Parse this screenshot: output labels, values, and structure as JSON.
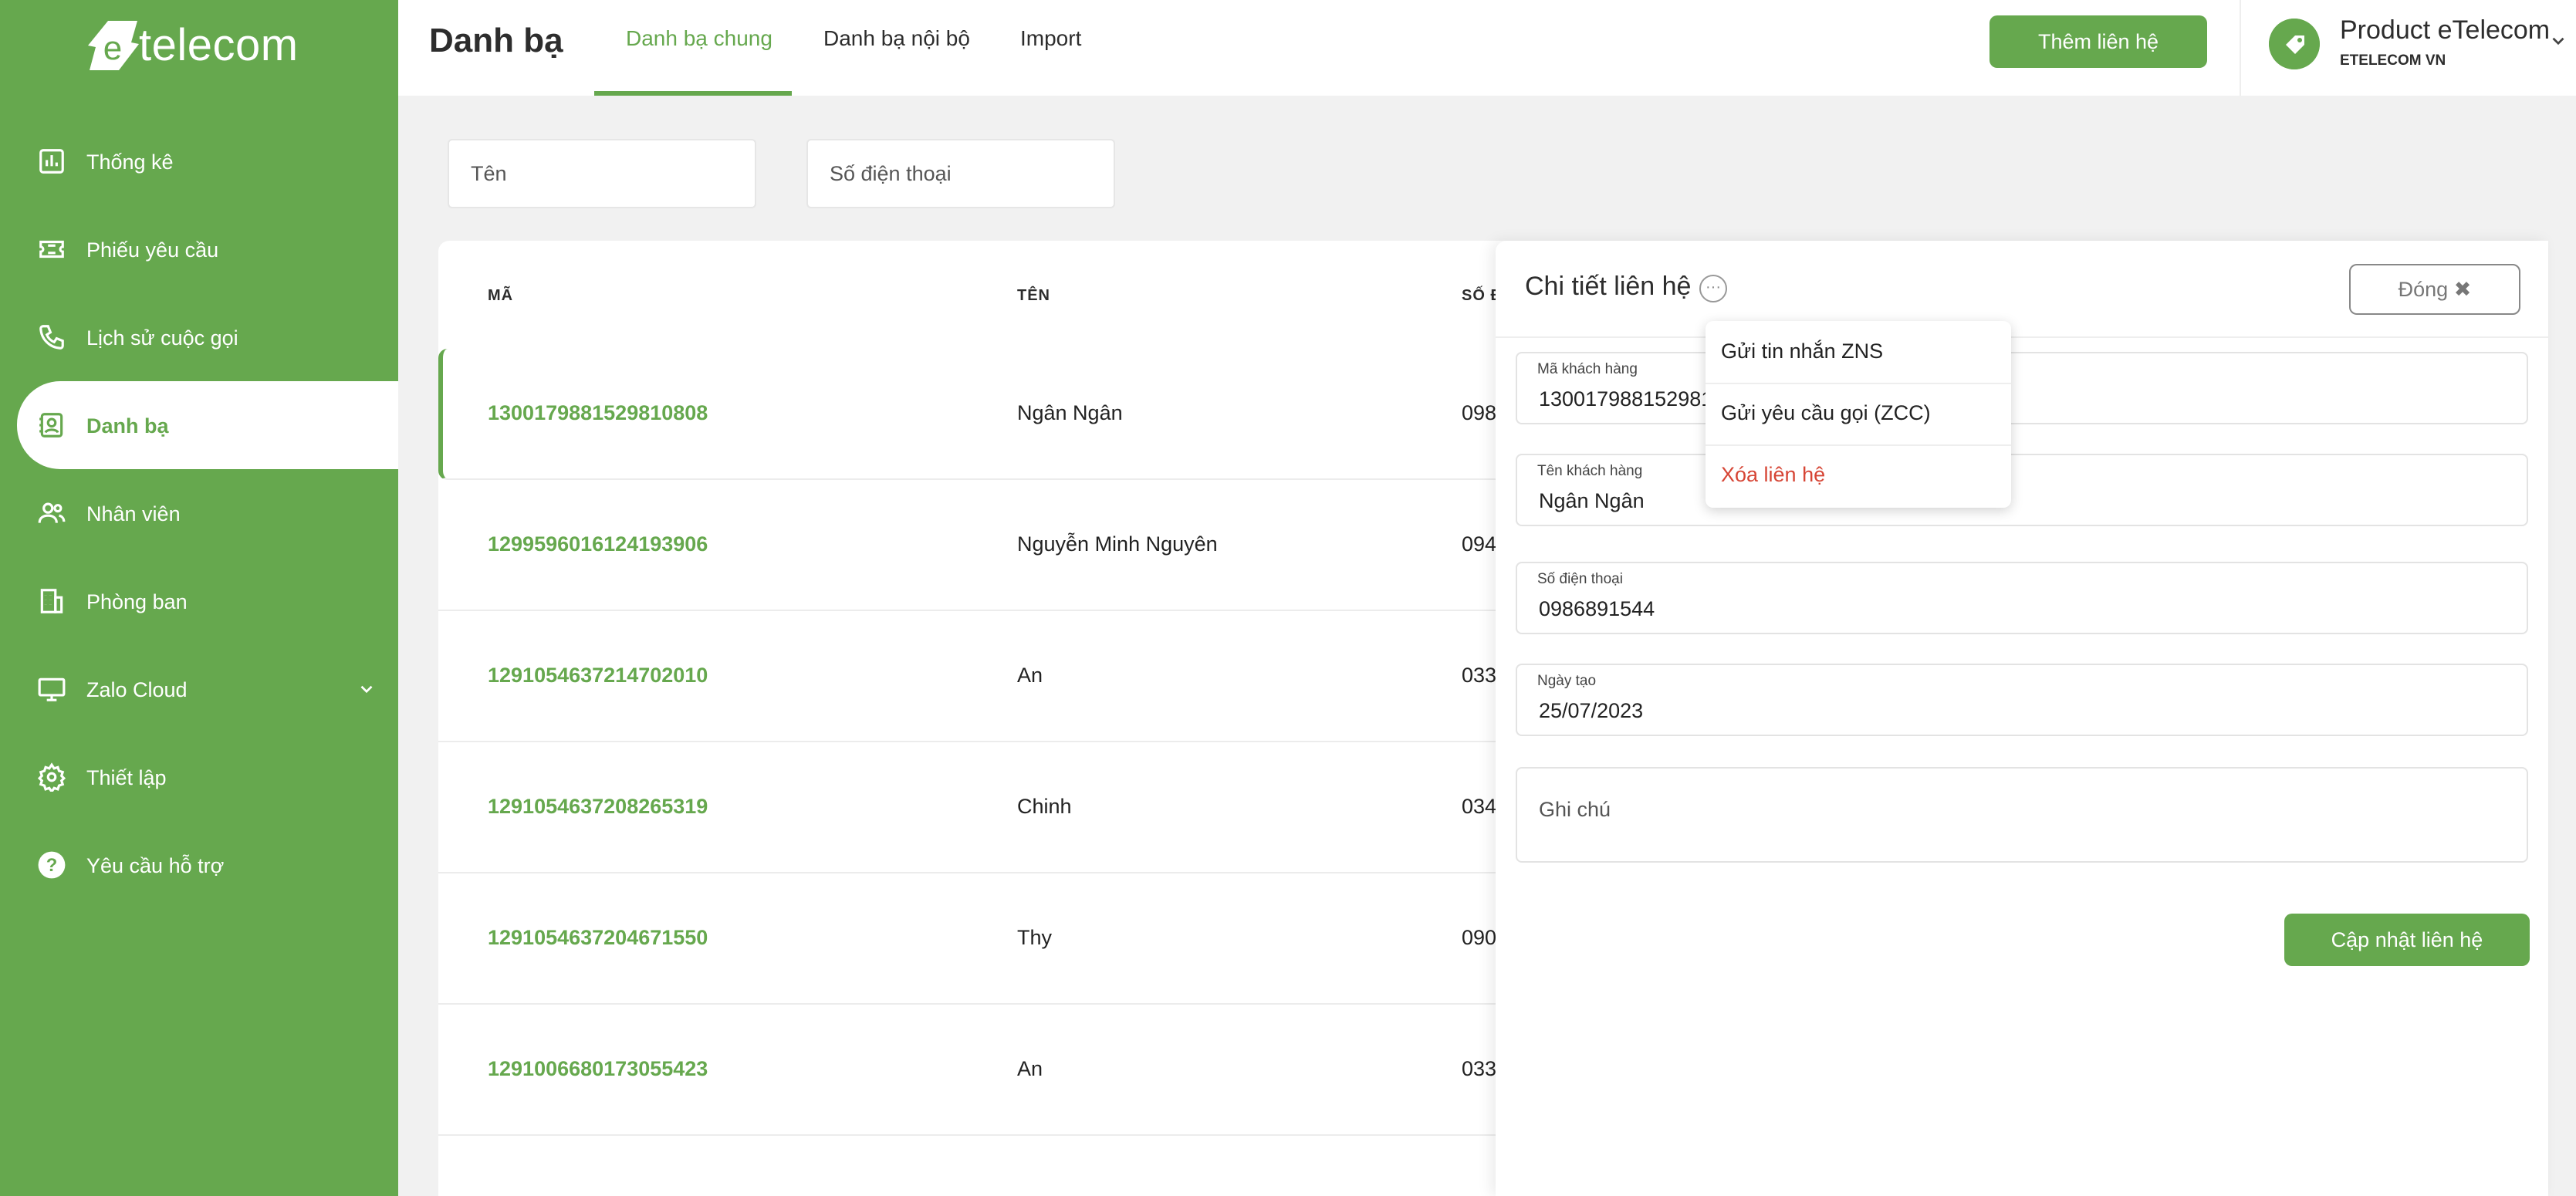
{
  "brand": {
    "logo_text": "telecom",
    "logo_letter": "e"
  },
  "sidebar": {
    "items": [
      {
        "label": "Thống kê",
        "icon": "bar-chart-icon"
      },
      {
        "label": "Phiếu yêu cầu",
        "icon": "ticket-icon"
      },
      {
        "label": "Lịch sử cuộc gọi",
        "icon": "phone-icon"
      },
      {
        "label": "Danh bạ",
        "icon": "contacts-icon",
        "active": true
      },
      {
        "label": "Nhân viên",
        "icon": "users-icon"
      },
      {
        "label": "Phòng ban",
        "icon": "building-icon"
      },
      {
        "label": "Zalo Cloud",
        "icon": "monitor-icon",
        "has_chevron": true
      },
      {
        "label": "Thiết lập",
        "icon": "gear-icon"
      },
      {
        "label": "Yêu cầu hỗ trợ",
        "icon": "help-icon"
      }
    ]
  },
  "header": {
    "title": "Danh bạ",
    "tabs": [
      {
        "label": "Danh bạ chung",
        "active": true
      },
      {
        "label": "Danh bạ nội bộ"
      },
      {
        "label": "Import"
      }
    ],
    "add_button": "Thêm liên hệ",
    "account": {
      "name": "Product eTelecom",
      "company": "ETELECOM VN"
    }
  },
  "filters": {
    "name_placeholder": "Tên",
    "phone_placeholder": "Số điện thoại"
  },
  "table": {
    "headers": {
      "code": "MÃ",
      "name": "TÊN",
      "phone": "SỐ Đ"
    },
    "rows": [
      {
        "code": "1300179881529810808",
        "name": "Ngân Ngân",
        "phone": "098"
      },
      {
        "code": "1299596016124193906",
        "name": "Nguyễn Minh Nguyên",
        "phone": "094"
      },
      {
        "code": "1291054637214702010",
        "name": "An",
        "phone": "033"
      },
      {
        "code": "1291054637208265319",
        "name": "Chinh",
        "phone": "034"
      },
      {
        "code": "1291054637204671550",
        "name": "Thy",
        "phone": "090"
      },
      {
        "code": "1291006680173055423",
        "name": "An",
        "phone": "033"
      }
    ]
  },
  "detail": {
    "title": "Chi tiết liên hệ",
    "close_button": "Đóng ✖",
    "fields": {
      "code_label": "Mã khách hàng",
      "code_value": "130017988152981",
      "name_label": "Tên khách hàng",
      "name_value": "Ngân Ngân",
      "phone_label": "Số điện thoại",
      "phone_value": "0986891544",
      "date_label": "Ngày tạo",
      "date_value": "25/07/2023",
      "note_placeholder": "Ghi chú"
    },
    "update_button": "Cập nhật liên hệ"
  },
  "dropdown": {
    "items": [
      {
        "label": "Gửi tin nhắn ZNS"
      },
      {
        "label": "Gửi yêu cầu gọi (ZCC)"
      },
      {
        "label": "Xóa liên hệ",
        "danger": true
      }
    ]
  },
  "colors": {
    "brand_green": "#66a84e",
    "danger_red": "#d64535"
  }
}
